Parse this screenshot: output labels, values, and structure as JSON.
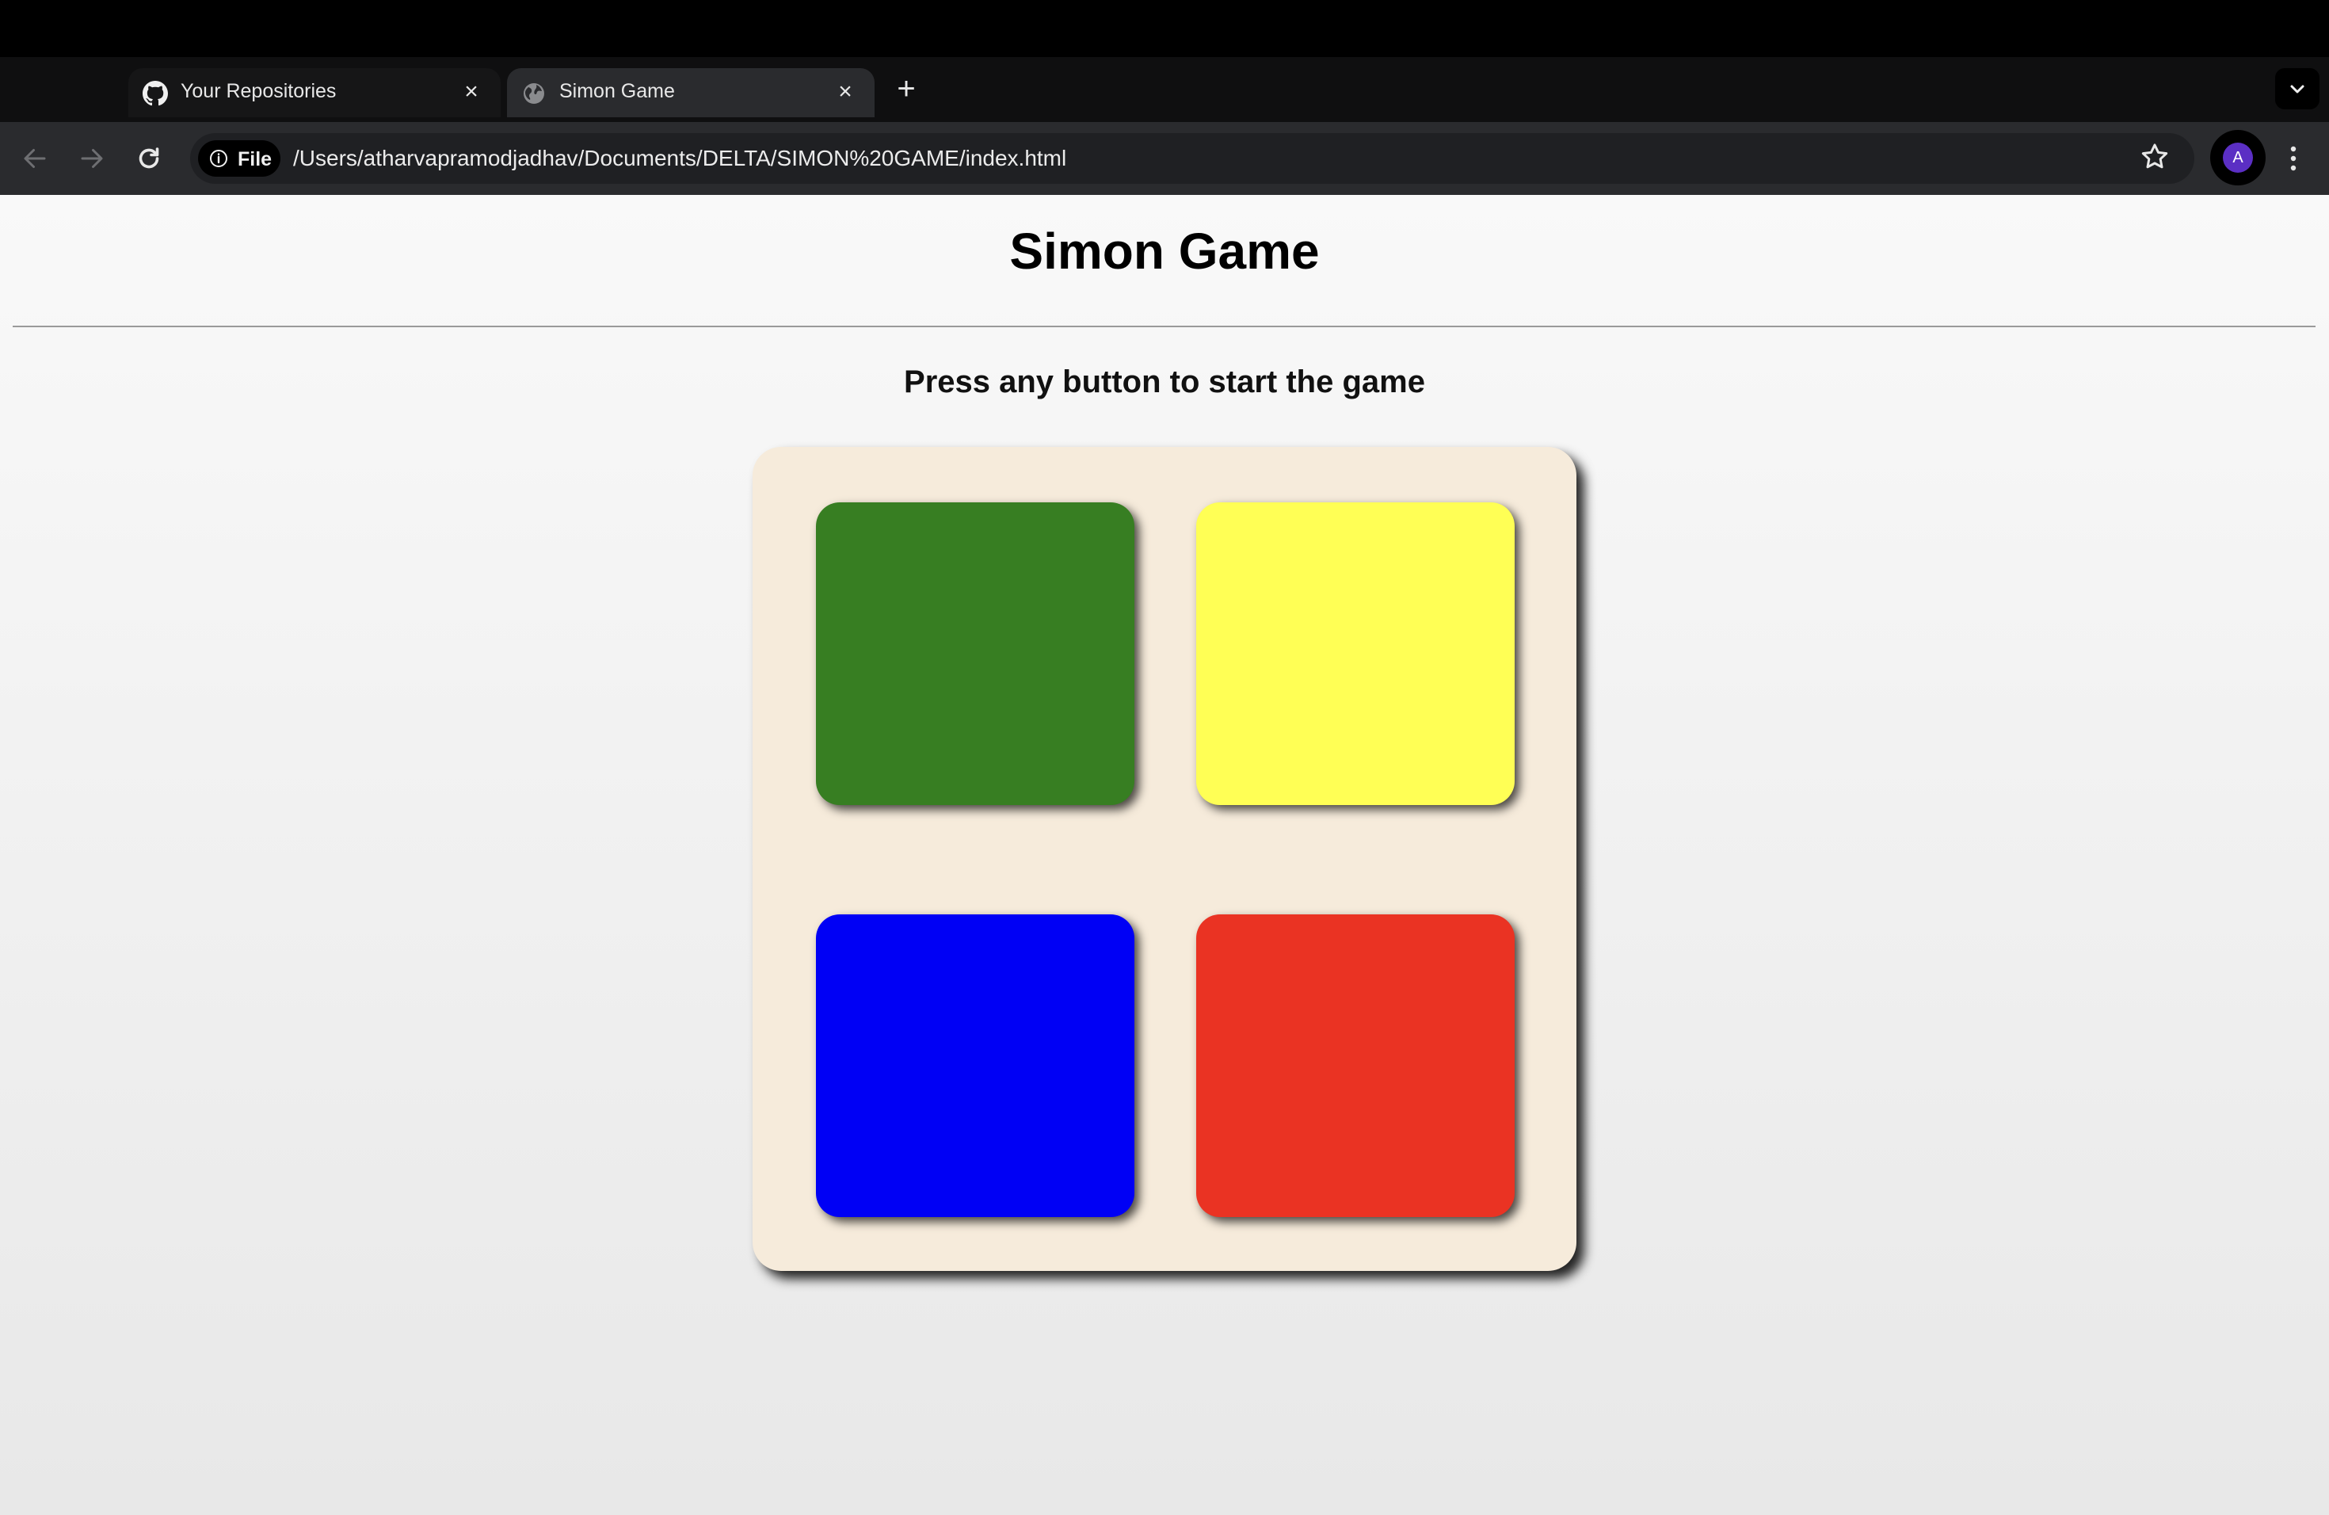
{
  "browser": {
    "tabs": [
      {
        "label": "Your Repositories",
        "icon": "github-icon",
        "active": false
      },
      {
        "label": "Simon Game",
        "icon": "globe-icon",
        "active": true
      }
    ],
    "new_tab_label": "+",
    "close_label": "×",
    "address_bar": {
      "chip_label": "File",
      "url": "/Users/atharvapramodjadhav/Documents/DELTA/SIMON%20GAME/index.html"
    },
    "profile_initial": "A"
  },
  "page": {
    "title": "Simon Game",
    "subtitle": "Press any button to start the game",
    "buttons": [
      {
        "id": "green",
        "color": "#377e22"
      },
      {
        "id": "yellow",
        "color": "#ffff55"
      },
      {
        "id": "blue",
        "color": "#0000f5"
      },
      {
        "id": "red",
        "color": "#ea3323"
      }
    ],
    "board_color": "#f6ebdb"
  }
}
